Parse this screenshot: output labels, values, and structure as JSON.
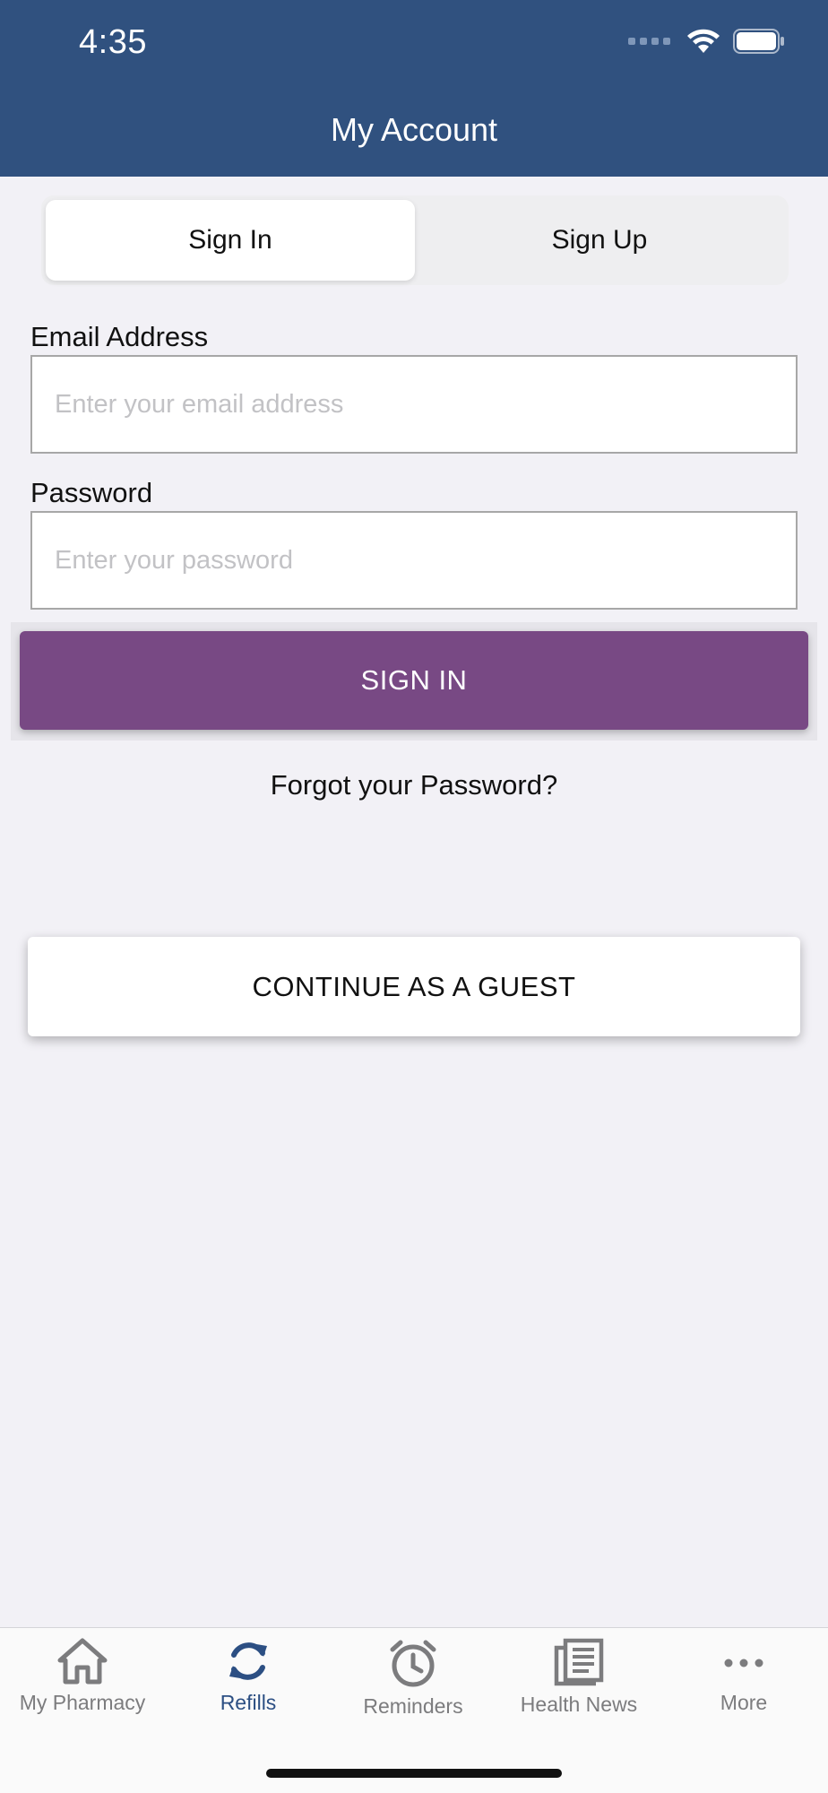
{
  "status_bar": {
    "time": "4:35"
  },
  "header": {
    "title": "My Account"
  },
  "tabs": {
    "sign_in": "Sign In",
    "sign_up": "Sign Up"
  },
  "form": {
    "email_label": "Email Address",
    "email_placeholder": "Enter your email address",
    "password_label": "Password",
    "password_placeholder": "Enter your password",
    "sign_in_button": "SIGN IN",
    "forgot_link": "Forgot your Password?",
    "guest_button": "CONTINUE AS A GUEST"
  },
  "tab_bar": {
    "items": [
      {
        "label": "My Pharmacy",
        "icon": "home-icon"
      },
      {
        "label": "Refills",
        "icon": "refresh-icon",
        "active": true
      },
      {
        "label": "Reminders",
        "icon": "alarm-clock-icon"
      },
      {
        "label": "Health News",
        "icon": "newspaper-icon"
      },
      {
        "label": "More",
        "icon": "more-dots-icon"
      }
    ]
  },
  "colors": {
    "header": "#30517f",
    "sign_in_button": "#784984",
    "active_tab": "#2c4f83",
    "background": "#f2f1f6"
  }
}
